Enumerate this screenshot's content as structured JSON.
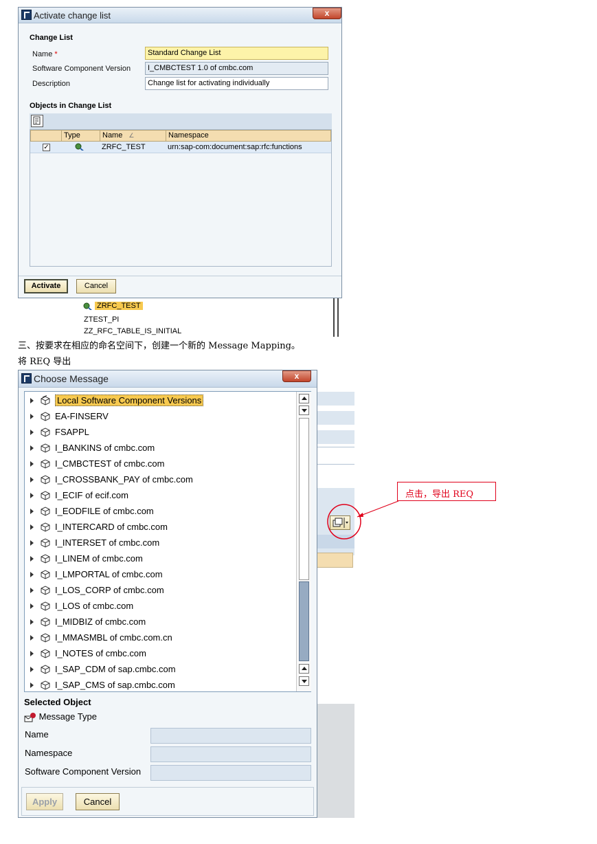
{
  "activate_dialog": {
    "title": "Activate change list",
    "close_label": "x",
    "change_list_heading": "Change List",
    "name_label": "Name",
    "required_mark": "*",
    "name_value": "Standard Change List",
    "scv_label": "Software Component Version",
    "scv_value": "I_CMBCTEST 1.0 of cmbc.com",
    "description_label": "Description",
    "description_value": "Change list for activating individually",
    "objects_heading": "Objects in Change List",
    "table_headers": [
      "Type",
      "Name",
      "Namespace"
    ],
    "sort_mark": "∠",
    "rows": [
      {
        "checked": "✓",
        "name": "ZRFC_TEST",
        "namespace": "urn:sap-com:document:sap:rfc:functions"
      }
    ],
    "activate_label": "Activate",
    "cancel_label": "Cancel"
  },
  "background_list": {
    "items": [
      "ZRFC_TEST",
      "ZTEST_PI",
      "ZZ_RFC_TABLE_IS_INITIAL"
    ]
  },
  "doc": {
    "line1": "三、按要求在相应的命名空间下，创建一个新的 Message Mapping。",
    "line2": "将 REQ 导出"
  },
  "choose_dialog": {
    "title": "Choose Message",
    "close_label": "x",
    "tree_items": [
      "Local Software Component Versions",
      "EA-FINSERV",
      "FSAPPL",
      "I_BANKINS of cmbc.com",
      "I_CMBCTEST of cmbc.com",
      "I_CROSSBANK_PAY of cmbc.com",
      "I_ECIF of ecif.com",
      "I_EODFILE of cmbc.com",
      "I_INTERCARD of cmbc.com",
      "I_INTERSET of cmbc.com",
      "I_LINEM of cmbc.com",
      "I_LMPORTAL of cmbc.com",
      "I_LOS_CORP of cmbc.com",
      "I_LOS of cmbc.com",
      "I_MIDBIZ of cmbc.com",
      "I_MMASMBL of cmbc.com.cn",
      "I_NOTES of cmbc.com",
      "I_SAP_CDM of sap.cmbc.com",
      "I_SAP_CMS of sap.cmbc.com"
    ],
    "selected_heading": "Selected Object",
    "message_type_label": "Message Type",
    "name_label": "Name",
    "namespace_label": "Namespace",
    "scv_label": "Software Component Version",
    "apply_label": "Apply",
    "cancel_label": "Cancel"
  },
  "annotation": {
    "text": "点击，导出 REQ",
    "color": "#e0001a"
  }
}
